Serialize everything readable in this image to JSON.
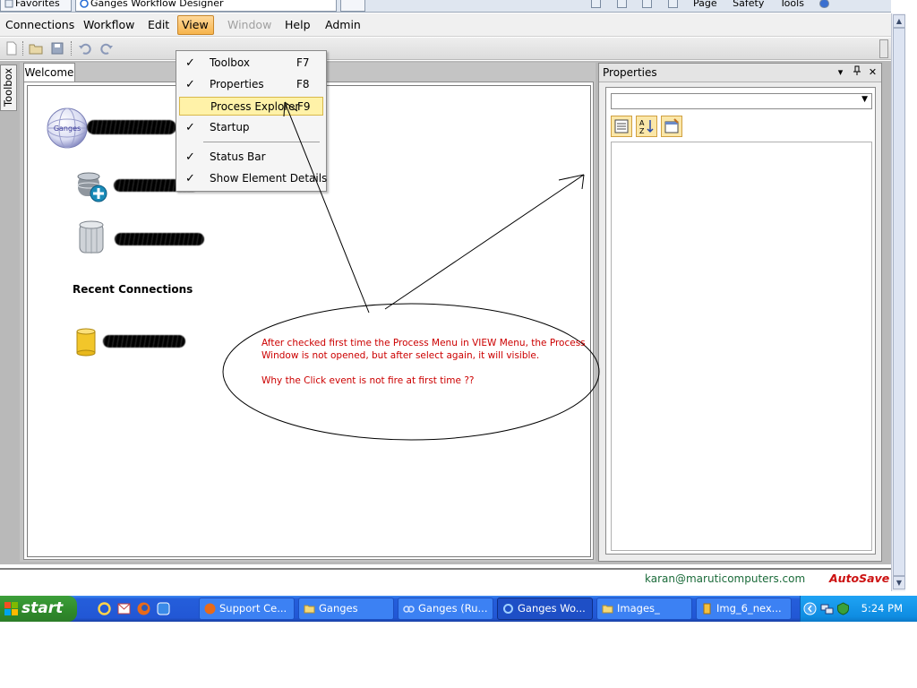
{
  "browser_tabs": [
    {
      "label": "Favorites"
    },
    {
      "label": "Ganges Workflow Designer"
    },
    {
      "label": ""
    }
  ],
  "browser_tools": {
    "page": "Page",
    "safety": "Safety",
    "tools": "Tools"
  },
  "menubar": {
    "items": [
      "Connections",
      "Workflow",
      "Edit",
      "View",
      "Window",
      "Help",
      "Admin"
    ]
  },
  "view_menu": {
    "items": [
      {
        "label": "Toolbox",
        "shortcut": "F7",
        "checked": "✓"
      },
      {
        "label": "Properties",
        "shortcut": "F8",
        "checked": "✓"
      },
      {
        "label": "Process Explorer",
        "shortcut": "F9",
        "checked": ""
      },
      {
        "label": "Startup",
        "shortcut": "",
        "checked": "✓"
      },
      {
        "label": "Status Bar",
        "shortcut": "",
        "checked": "✓"
      },
      {
        "label": "Show Element Details",
        "shortcut": "",
        "checked": "✓"
      }
    ]
  },
  "toolbox_tab": "Toolbox",
  "document": {
    "tab": "Welcome",
    "logo_text": "Ganges",
    "recent_label": "Recent Connections"
  },
  "properties": {
    "title": "Properties",
    "header_buttons": [
      "▾",
      "↓",
      "✕"
    ]
  },
  "status": {
    "email": "karan@maruticomputers.com",
    "autosave": "AutoSave"
  },
  "annotation": {
    "lines": [
      "After checked first time the Process Menu in VIEW Menu, the Process",
      "Window is not opened, but after select again, it will visible.",
      "Why the Click event is not fire at first time ??"
    ]
  },
  "taskbar": {
    "start": "start",
    "buttons": [
      "Support Ce...",
      "Ganges",
      "Ganges (Ru...",
      "Ganges Wo...",
      "Images_",
      "Img_6_nex..."
    ],
    "clock": "5:24 PM"
  },
  "colors": {
    "annotation": "#cc0000",
    "autosave": "#cc1111",
    "email": "#1b6b3a",
    "menu_active": "#f6b44c",
    "highlight": "#fff2a8"
  }
}
